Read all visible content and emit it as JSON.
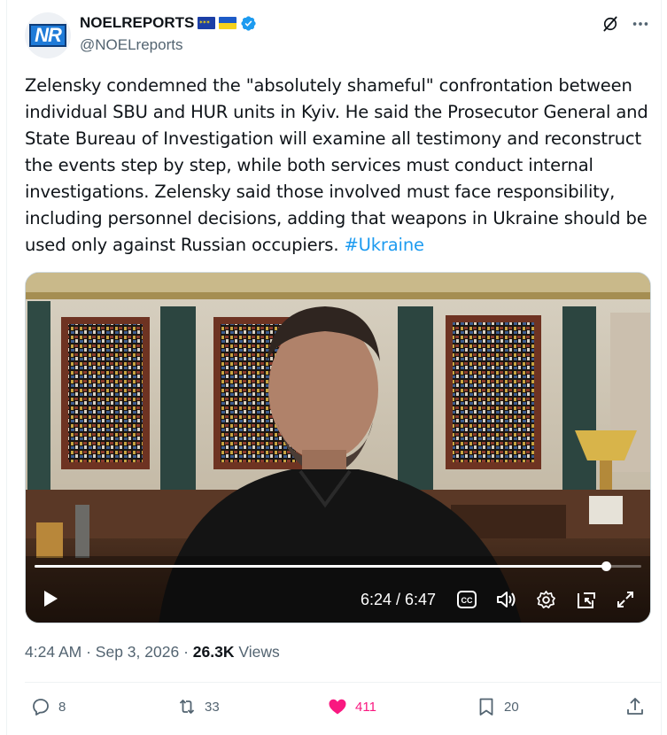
{
  "author": {
    "display_name": "NOELREPORTS",
    "handle": "@NOELreports",
    "avatar_text": "NR",
    "flags": [
      "eu-flag",
      "ukraine-flag"
    ],
    "verified": true
  },
  "tweet": {
    "text": "Zelensky condemned the \"absolutely shameful\" confrontation between individual SBU and HUR units in Kyiv. He said the Prosecutor General and State Bureau of Investigation will examine all testimony and reconstruct the events step by step, while both services must conduct internal investigations. Zelensky said those involved must face responsibility, including personnel decisions, adding that weapons in Ukraine should be used only against Russian occupiers.",
    "hashtag": "#Ukraine"
  },
  "video": {
    "time_display": "6:24 / 6:47",
    "progress_fraction": 0.943
  },
  "meta": {
    "time": "4:24 AM",
    "separator": "·",
    "date": "Sep 3, 2026",
    "views_count": "26.3K",
    "views_label": "Views"
  },
  "actions": {
    "replies": "8",
    "reposts": "33",
    "likes": "411",
    "bookmarks": "20"
  },
  "colors": {
    "accent": "#1d9bf0",
    "like": "#f91880",
    "secondary_text": "#536471",
    "verified": "#1d9bf0"
  }
}
